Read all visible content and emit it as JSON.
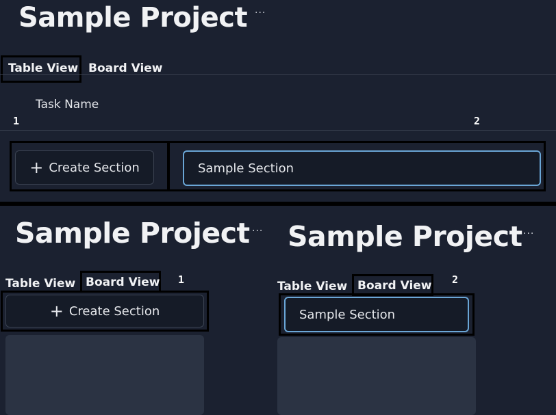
{
  "panel_table": {
    "project_title": "Sample Project",
    "more_menu": "···",
    "tabs": [
      "Table View",
      "Board View"
    ],
    "column_header": "Task Name",
    "marker_left": "1",
    "marker_right": "2",
    "create_section_label": "Create Section",
    "section_input_value": "Sample Section"
  },
  "panel_board_1": {
    "project_title": "Sample Project",
    "more_menu": "···",
    "tabs": [
      "Table View",
      "Board View"
    ],
    "marker": "1",
    "create_section_label": "Create Section"
  },
  "panel_board_2": {
    "project_title": "Sample Project",
    "more_menu": "···",
    "tabs": [
      "Table View",
      "Board View"
    ],
    "marker": "2",
    "section_input_value": "Sample Section"
  },
  "icons": {
    "plus": "plus-icon",
    "more": "more-horizontal-icon"
  },
  "colors": {
    "background": "#1b2130",
    "input_focus_border": "#6aa6d6",
    "card": "#2b3343",
    "annotation_outline": "#000000"
  }
}
